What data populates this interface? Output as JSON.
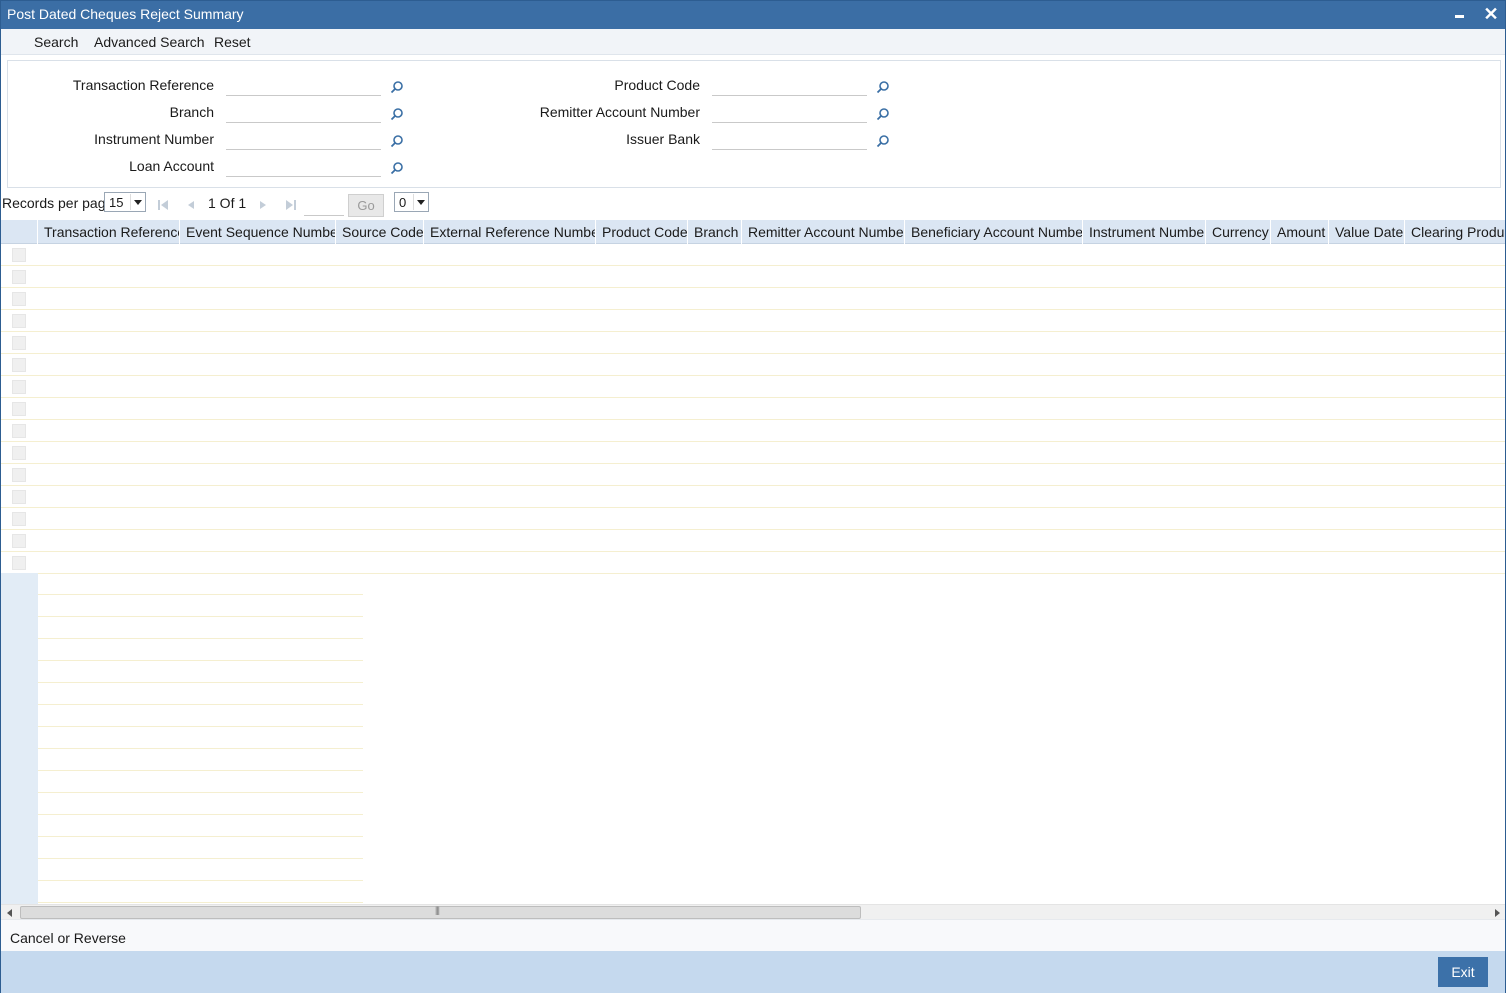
{
  "window": {
    "title": "Post Dated Cheques Reject Summary"
  },
  "menu": {
    "search": "Search",
    "advanced_search": "Advanced Search",
    "reset": "Reset"
  },
  "criteria": {
    "transaction_reference": "Transaction Reference",
    "branch": "Branch",
    "instrument_number": "Instrument Number",
    "loan_account": "Loan Account",
    "product_code": "Product Code",
    "remitter_account_number": "Remitter Account Number",
    "issuer_bank": "Issuer Bank"
  },
  "pager": {
    "records_label": "Records per page",
    "records_value": "15",
    "page_info": "1 Of 1",
    "go_label": "Go",
    "jump_value": "0"
  },
  "grid": {
    "columns": [
      "Transaction Reference",
      "Event Sequence Number",
      "Source Code",
      "External Reference Number",
      "Product Code",
      "Branch",
      "Remitter Account Number",
      "Beneficiary Account Number",
      "Instrument Number",
      "Currency",
      "Amount",
      "Value Date",
      "Clearing Product"
    ]
  },
  "actions": {
    "cancel_or_reverse": "Cancel or Reverse"
  },
  "footer": {
    "exit_label": "Exit"
  },
  "colors": {
    "titlebar": "#3b6ea5",
    "header_row": "#dbe6f3",
    "footer": "#c5d9ee",
    "exit_button": "#3c71a9"
  }
}
